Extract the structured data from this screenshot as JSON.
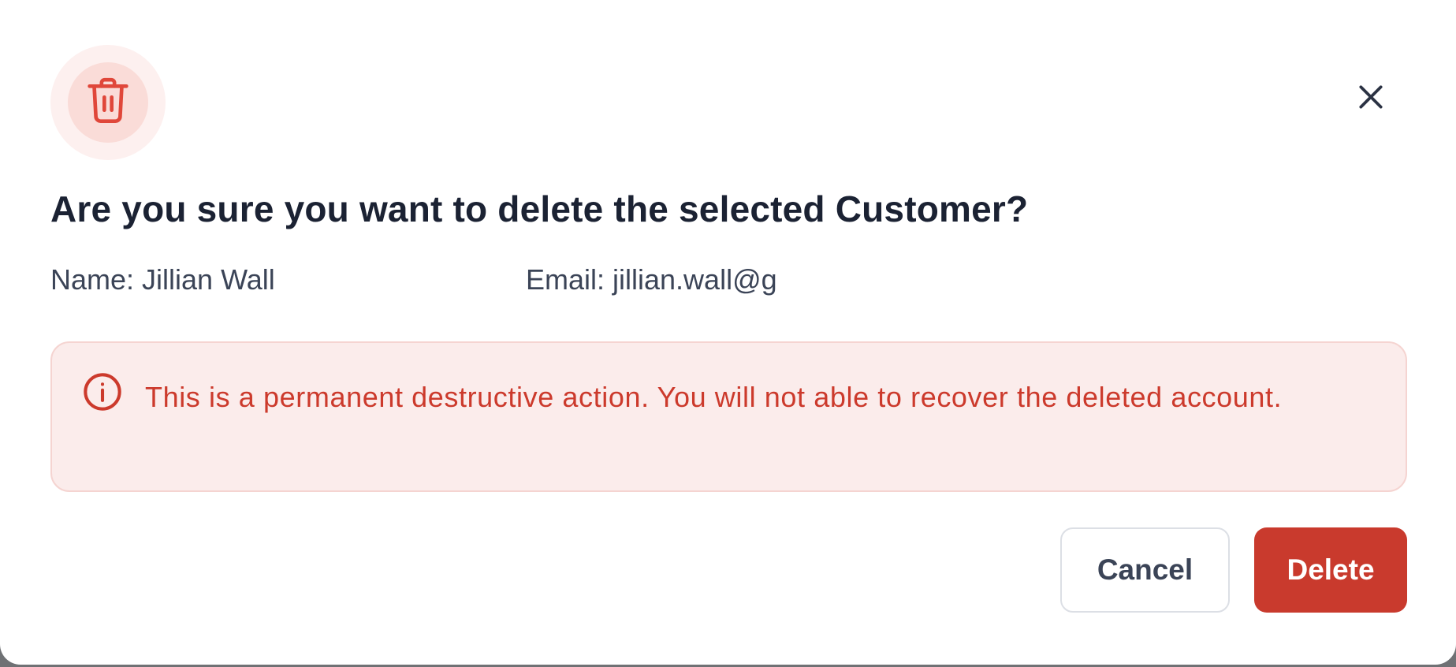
{
  "dialog": {
    "title": "Are you sure you want to delete the selected Customer?",
    "name_text": "Name: Jillian Wall",
    "email_text": "Email: jillian.wall@g",
    "warning_text": "This is a permanent destructive action. You will not able to recover the deleted account.",
    "cancel_label": "Cancel",
    "delete_label": "Delete"
  },
  "icons": {
    "header": "trash-icon",
    "close": "close-icon",
    "warning": "info-circle-icon"
  },
  "colors": {
    "danger": "#c93a2d",
    "danger_text": "#cc3a2c",
    "alert_bg": "#fbeceb",
    "title": "#1b2233"
  }
}
